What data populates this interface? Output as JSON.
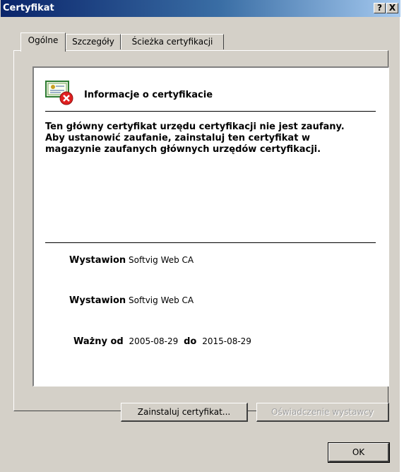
{
  "window": {
    "title": "Certyfikat",
    "help_label": "?",
    "close_label": "X"
  },
  "tabs": [
    {
      "label": "Ogólne"
    },
    {
      "label": "Szczegóły"
    },
    {
      "label": "Ścieżka certyfikacji"
    }
  ],
  "info": {
    "heading": "Informacje o certyfikacie",
    "message": "Ten główny certyfikat urzędu certyfikacji nie jest zaufany. Aby ustanowić zaufanie, zainstaluj ten certyfikat w magazynie zaufanych głównych urzędów certyfikacji."
  },
  "details": {
    "issued_to_label": "Wystawion",
    "issued_to_value": "Softvig Web CA",
    "issued_by_label": "Wystawion",
    "issued_by_value": "Softvig Web CA",
    "valid_from_label": "Ważny od",
    "valid_from_value": "2005-08-29",
    "valid_to_label": "do",
    "valid_to_value": "2015-08-29"
  },
  "buttons": {
    "install": "Zainstaluj certyfikat...",
    "issuer_statement": "Oświadczenie wystawcy",
    "ok": "OK"
  },
  "icons": {
    "certificate": "certificate-icon",
    "error": "error-x-icon"
  }
}
